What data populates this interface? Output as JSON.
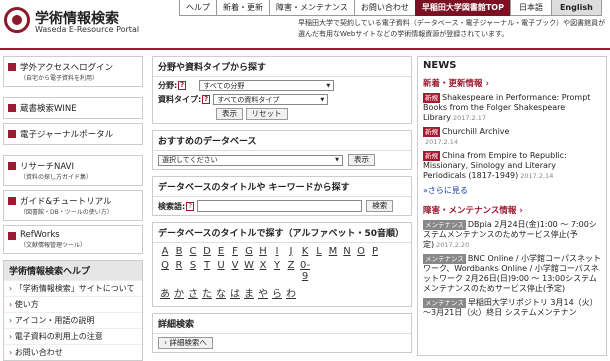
{
  "logo": {
    "title": "学術情報検索",
    "subtitle": "Waseda E-Resource Portal"
  },
  "topnav": {
    "help": "ヘルプ",
    "news": "新着・更新",
    "maint": "障害・メンテナンス",
    "contact": "お問い合わせ",
    "library": "早稲田大学図書館TOP",
    "ja": "日本語",
    "en": "English"
  },
  "notice": "早稲田大学で契約している電子資料（データベース・電子ジャーナル・電子ブック）や図書館員が選んだ有用なWebサイトなどの学術情報資源が登録されています。",
  "left": {
    "items": [
      {
        "label": "学外アクセスへログイン",
        "sub": "（自宅から電子資料を利用）"
      },
      {
        "label": "蔵書検索WINE",
        "sub": ""
      },
      {
        "label": "電子ジャーナルポータル",
        "sub": ""
      },
      {
        "label": "リサーチNAVI",
        "sub": "（資料の探し方ガイド集）"
      },
      {
        "label": "ガイド&チュートリアル",
        "sub": "（図書館・DB・ツールの使い方）"
      },
      {
        "label": "RefWorks",
        "sub": "（文献情報管理ツール）"
      }
    ],
    "help": {
      "title": "学術情報検索ヘルプ",
      "items": [
        "「学術情報検索」サイトについて",
        "使い方",
        "アイコン・用語の説明",
        "電子資料の利用上の注意",
        "お問い合わせ"
      ]
    }
  },
  "search_type": {
    "title": "分野や資料タイプから探す",
    "field_label": "分野:",
    "field_value": "すべての分野",
    "type_label": "資料タイプ:",
    "type_value": "すべての資料タイプ",
    "q_mark": "?",
    "search_btn": "表示",
    "reset_btn": "リセット"
  },
  "recommend": {
    "title": "おすすめのデータベース",
    "select_value": "選択してください",
    "btn": "表示"
  },
  "keyword": {
    "title": "データベースのタイトルや キーワードから探す",
    "label": "検索語:",
    "btn": "検索"
  },
  "alpha": {
    "title": "データベースのタイトルで探す（アルファベット・50音順）",
    "latin": [
      "A",
      "B",
      "C",
      "D",
      "E",
      "F",
      "G",
      "H",
      "I",
      "J",
      "K",
      "L",
      "M",
      "N",
      "O",
      "P",
      "Q",
      "R",
      "S",
      "T",
      "U",
      "V",
      "W",
      "X",
      "Y",
      "Z",
      "0-9"
    ],
    "kana": [
      "あ",
      "か",
      "さ",
      "た",
      "な",
      "は",
      "ま",
      "や",
      "ら",
      "わ"
    ]
  },
  "detail": {
    "title": "詳細検索",
    "btn": "詳細検索へ"
  },
  "news": {
    "title": "NEWS",
    "section": "新着・更新情報 ›",
    "items": [
      {
        "tag": "新規",
        "text": "Shakespeare in Performance: Prompt Books from the Folger Shakespeare Library",
        "date": "2017.2.17"
      },
      {
        "tag": "新規",
        "text": "Churchill Archive",
        "date": "2017.2.14"
      },
      {
        "tag": "新規",
        "text": "China from Empire to Republic: Missionary, Sinology and Literary Periodicals (1817-1949)",
        "date": "2017.2.14"
      }
    ],
    "more": "»さらに見る",
    "maint_section": "障害・メンテナンス情報 ›",
    "maint": [
      {
        "tag": "メンテナンス",
        "text": "DBpia 2月24日(金)1:00 ～ 7:00システムメンテナンスのためサービス停止(予定)",
        "date": "2017.2.20"
      },
      {
        "tag": "メンテナンス",
        "text": "BNC Online / 小学館コーパスネットワーク、Wordbanks Online / 小学館コーパスネットワーク 2月26日(日)9:00 ～ 13:00システムメンテナンスのためサービス停止(予定)",
        "date": ""
      },
      {
        "tag": "メンテナンス",
        "text": "早稲田大学リポジトリ 3月14（火）～3月21日（火）終日 システムメンテナン",
        "date": ""
      }
    ]
  }
}
